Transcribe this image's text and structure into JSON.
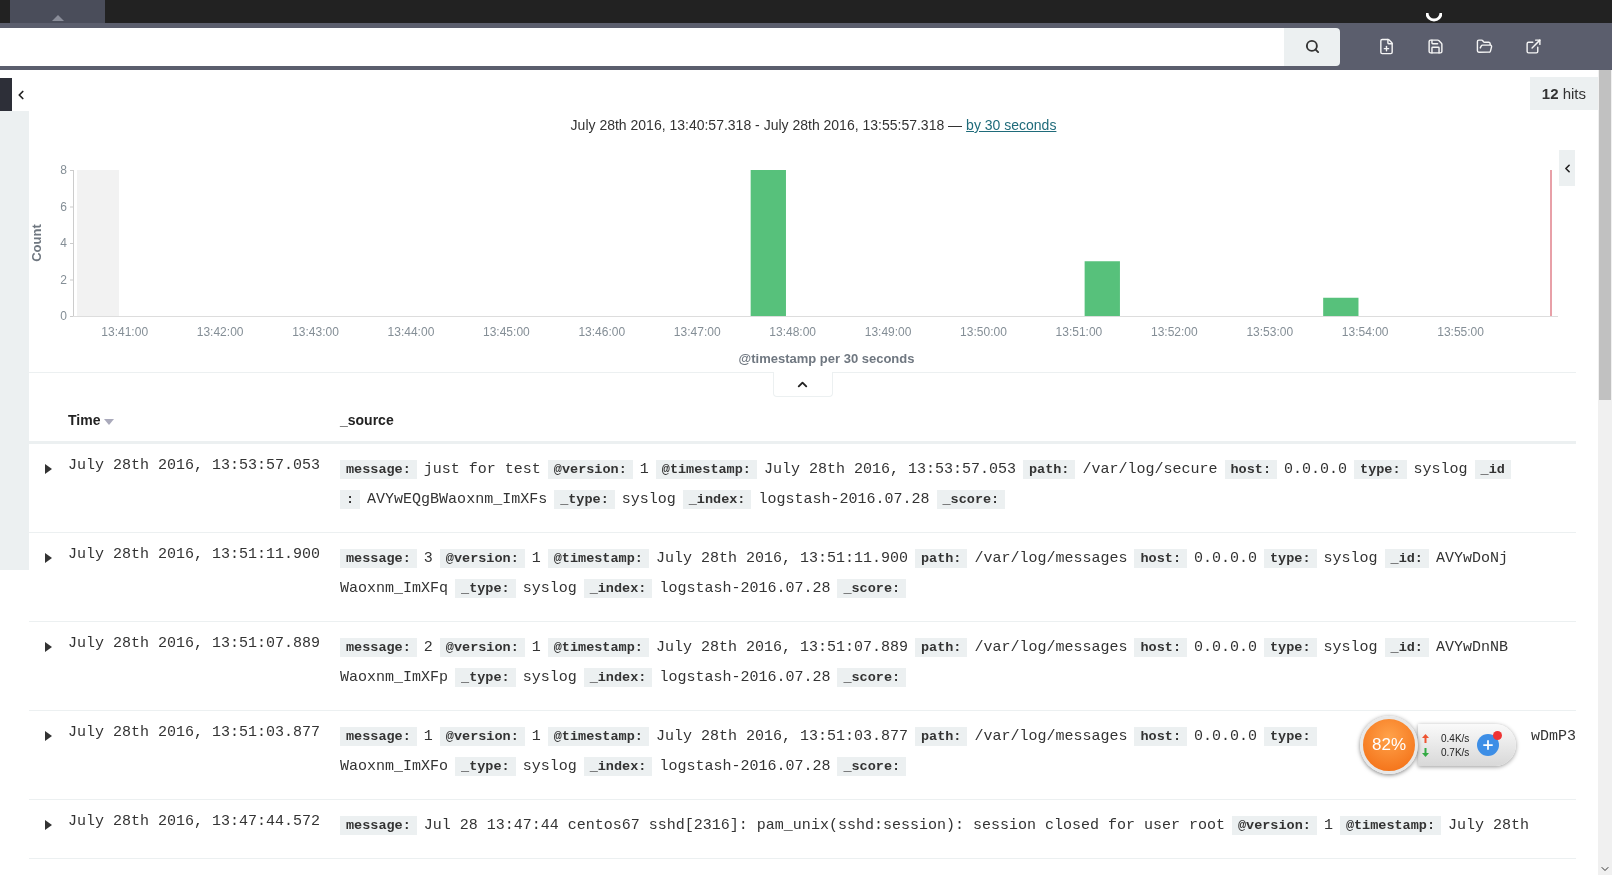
{
  "hits": "**12** hits",
  "time_range": {
    "text": "July 28th 2016, 13:40:57.318 - July 28th 2016, 13:55:57.318 —",
    "interval_link": "by 30 seconds"
  },
  "chart": {
    "chart_data": {
      "type": "bar",
      "xlabel": "@timestamp per 30 seconds",
      "ylabel": "Count",
      "categories": [
        null,
        "13:41:00",
        null,
        "13:42:00",
        null,
        "13:43:00",
        null,
        "13:44:00",
        null,
        "13:45:00",
        null,
        "13:46:00",
        null,
        "13:47:00",
        null,
        "13:48:00",
        null,
        "13:49:00",
        null,
        "13:50:00",
        null,
        "13:51:00",
        null,
        "13:52:00",
        null,
        "13:53:00",
        null,
        "13:54:00",
        null,
        "13:55:00",
        null
      ],
      "values": [
        0,
        0,
        0,
        0,
        0,
        0,
        0,
        0,
        0,
        0,
        0,
        0,
        0,
        0,
        8,
        0,
        0,
        0,
        0,
        0,
        0,
        3,
        0,
        0,
        0,
        0,
        1,
        0,
        0,
        0,
        0
      ],
      "ylim": [
        0,
        8
      ],
      "yticks": [
        0,
        2,
        4,
        6,
        8
      ]
    }
  },
  "table": {
    "columns": [
      {
        "label": "Time",
        "sortable": true
      },
      {
        "label": "_source",
        "sortable": false
      }
    ],
    "rows": [
      {
        "time": "July 28th 2016, 13:53:57.053",
        "lines": [
          [
            {
              "kind": "field",
              "key": "message:",
              "value": "just for test"
            },
            {
              "kind": "field",
              "key": "@version:",
              "value": "1"
            },
            {
              "kind": "field",
              "key": "@timestamp:",
              "value": "July 28th 2016, 13:53:57.053"
            },
            {
              "kind": "field",
              "key": "path:",
              "value": "/var/log/secure"
            },
            {
              "kind": "field",
              "key": "host:",
              "value": "0.0.0.0"
            },
            {
              "kind": "field",
              "key": "type:",
              "value": "syslog"
            },
            {
              "kind": "field",
              "key": "_id"
            }
          ],
          [
            {
              "kind": "field",
              "key": ":",
              "value": "AVYwEQgBWaoxnm_ImXFs"
            },
            {
              "kind": "field",
              "key": "_type:",
              "value": "syslog"
            },
            {
              "kind": "field",
              "key": "_index:",
              "value": "logstash-2016.07.28"
            },
            {
              "kind": "field",
              "key": "_score:"
            }
          ]
        ]
      },
      {
        "time": "July 28th 2016, 13:51:11.900",
        "lines": [
          [
            {
              "kind": "field",
              "key": "message:",
              "value": "3"
            },
            {
              "kind": "field",
              "key": "@version:",
              "value": "1"
            },
            {
              "kind": "field",
              "key": "@timestamp:",
              "value": "July 28th 2016, 13:51:11.900"
            },
            {
              "kind": "field",
              "key": "path:",
              "value": "/var/log/messages"
            },
            {
              "kind": "field",
              "key": "host:",
              "value": "0.0.0.0"
            },
            {
              "kind": "field",
              "key": "type:",
              "value": "syslog"
            },
            {
              "kind": "field",
              "key": "_id:",
              "value": "AVYwDoNj"
            }
          ],
          [
            {
              "kind": "field",
              "value": "Waoxnm_ImXFq"
            },
            {
              "kind": "field",
              "key": "_type:",
              "value": "syslog"
            },
            {
              "kind": "field",
              "key": "_index:",
              "value": "logstash-2016.07.28"
            },
            {
              "kind": "field",
              "key": "_score:"
            }
          ]
        ]
      },
      {
        "time": "July 28th 2016, 13:51:07.889",
        "lines": [
          [
            {
              "kind": "field",
              "key": "message:",
              "value": "2"
            },
            {
              "kind": "field",
              "key": "@version:",
              "value": "1"
            },
            {
              "kind": "field",
              "key": "@timestamp:",
              "value": "July 28th 2016, 13:51:07.889"
            },
            {
              "kind": "field",
              "key": "path:",
              "value": "/var/log/messages"
            },
            {
              "kind": "field",
              "key": "host:",
              "value": "0.0.0.0"
            },
            {
              "kind": "field",
              "key": "type:",
              "value": "syslog"
            },
            {
              "kind": "field",
              "key": "_id:",
              "value": "AVYwDnNB"
            }
          ],
          [
            {
              "kind": "field",
              "value": "Waoxnm_ImXFp"
            },
            {
              "kind": "field",
              "key": "_type:",
              "value": "syslog"
            },
            {
              "kind": "field",
              "key": "_index:",
              "value": "logstash-2016.07.28"
            },
            {
              "kind": "field",
              "key": "_score:"
            }
          ]
        ]
      },
      {
        "time": "July 28th 2016, 13:51:03.877",
        "lines": [
          [
            {
              "kind": "field",
              "key": "message:",
              "value": "1"
            },
            {
              "kind": "field",
              "key": "@version:",
              "value": "1"
            },
            {
              "kind": "field",
              "key": "@timestamp:",
              "value": "July 28th 2016, 13:51:03.877"
            },
            {
              "kind": "field",
              "key": "path:",
              "value": "/var/log/messages"
            },
            {
              "kind": "field",
              "key": "host:",
              "value": "0.0.0.0"
            },
            {
              "kind": "field",
              "key": "type:"
            },
            {
              "kind": "tail",
              "value": "wDmP3"
            }
          ],
          [
            {
              "kind": "field",
              "value": "Waoxnm_ImXFo"
            },
            {
              "kind": "field",
              "key": "_type:",
              "value": "syslog"
            },
            {
              "kind": "field",
              "key": "_index:",
              "value": "logstash-2016.07.28"
            },
            {
              "kind": "field",
              "key": "_score:"
            }
          ]
        ]
      },
      {
        "time": "July 28th 2016, 13:47:44.572",
        "lines": [
          [
            {
              "kind": "field",
              "key": "message:",
              "value": "Jul 28 13:47:44 centos67 sshd[2316]: pam_unix(sshd:session): session closed for user root"
            },
            {
              "kind": "field",
              "key": "@version:",
              "value": "1"
            },
            {
              "kind": "field",
              "key": "@timestamp:",
              "value": "July 28th"
            }
          ]
        ]
      }
    ]
  },
  "system_monitor": {
    "percent": "82%",
    "upload": "0.4K/s",
    "download": "0.7K/s"
  }
}
